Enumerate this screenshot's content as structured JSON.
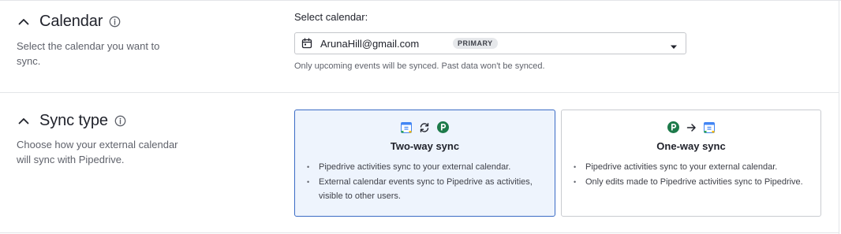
{
  "calendar_section": {
    "title": "Calendar",
    "description": "Select the calendar you want to sync.",
    "field_label": "Select calendar:",
    "selected_calendar": "ArunaHill@gmail.com",
    "badge": "PRIMARY",
    "helper": "Only upcoming events will be synced. Past data won't be synced."
  },
  "sync_section": {
    "title": "Sync type",
    "description": "Choose how your external calendar will sync with Pipedrive.",
    "options": [
      {
        "title": "Two-way sync",
        "selected": true,
        "bullets": [
          "Pipedrive activities sync to your external calendar.",
          "External calendar events sync to Pipedrive as activities, visible to other users."
        ]
      },
      {
        "title": "One-way sync",
        "selected": false,
        "bullets": [
          "Pipedrive activities sync to your external calendar.",
          "Only edits made to Pipedrive activities sync to Pipedrive."
        ]
      }
    ]
  },
  "icons": {
    "chevron": "chevron-up-icon",
    "info": "info-icon",
    "calendar": "calendar-icon",
    "dropdown": "caret-down-icon",
    "google_calendar": "google-calendar-icon",
    "sync": "two-way-sync-icon",
    "arrow": "arrow-right-icon",
    "pipedrive": "pipedrive-logo-icon"
  },
  "colors": {
    "selected_border": "#3a6bc5",
    "selected_bg": "#eef4fd",
    "pipedrive_green": "#1d7a4a",
    "text": "#21232c",
    "muted": "#5f626b"
  }
}
